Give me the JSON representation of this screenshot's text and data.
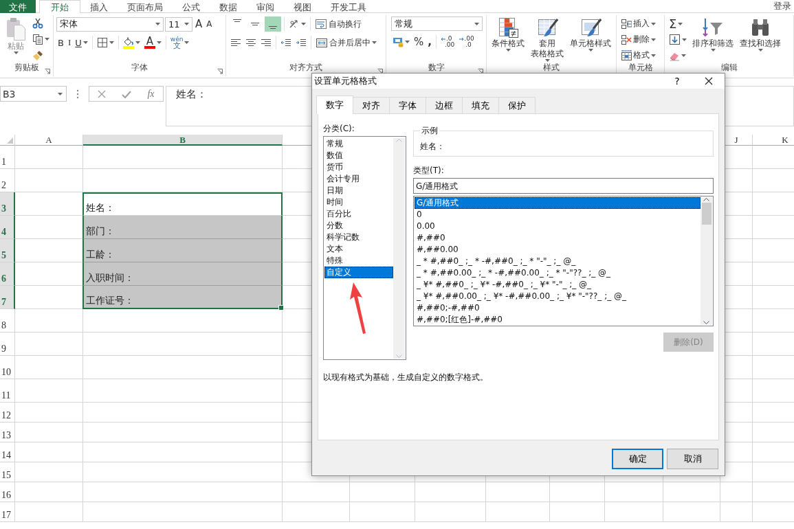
{
  "ribbon_tabs": [
    {
      "label": "文件",
      "kind": "file",
      "selected": false
    },
    {
      "label": "开始",
      "kind": "tab",
      "selected": true
    },
    {
      "label": "插入",
      "kind": "tab",
      "selected": false
    },
    {
      "label": "页面布局",
      "kind": "tab",
      "selected": false
    },
    {
      "label": "公式",
      "kind": "tab",
      "selected": false
    },
    {
      "label": "数据",
      "kind": "tab",
      "selected": false
    },
    {
      "label": "审阅",
      "kind": "tab",
      "selected": false
    },
    {
      "label": "视图",
      "kind": "tab",
      "selected": false
    },
    {
      "label": "开发工具",
      "kind": "tab",
      "selected": false
    }
  ],
  "account": "登录",
  "ribbon": {
    "clipboard": {
      "label": "剪贴板",
      "launcher": true,
      "paste": "粘贴",
      "paste_disabled": true
    },
    "font": {
      "label": "字体",
      "launcher": true,
      "font_name": "宋体",
      "font_size": "11",
      "grow": "A",
      "shrink": "A",
      "bold": "B",
      "italic": "I",
      "underline": "U",
      "fill": {
        "color": "#ffff00"
      },
      "font_color": {
        "letter": "A",
        "color": "#ff0000"
      },
      "phonetic_top": "wén",
      "phonetic_bottom": "文"
    },
    "alignment": {
      "label": "对齐方式",
      "launcher": true,
      "vertical": [
        {
          "selected": false
        },
        {
          "selected": false
        },
        {
          "selected": true
        }
      ],
      "wrap_text": "自动换行",
      "merge_center": "合并后居中"
    },
    "number": {
      "label": "数字",
      "launcher": true,
      "format": "常规",
      "percent": "%",
      "comma": ",",
      "increase_decimal": [
        ".0",
        ".00"
      ],
      "decrease_decimal": [
        ".00",
        ".0"
      ]
    },
    "styles": {
      "label": "样式",
      "conditional": "条件格式",
      "table_format": [
        "套用",
        "表格格式"
      ],
      "cell_styles": "单元格样式"
    },
    "cells": {
      "label": "单元格",
      "insert": "插入",
      "delete": "删除",
      "format": "格式"
    },
    "editing": {
      "label": "编辑",
      "autosum": "Σ",
      "sort_filter": "排序和筛选",
      "find_select": "查找和选择"
    }
  },
  "formula_bar": {
    "name_box": "B3",
    "function_button": "fx",
    "formula": "姓名："
  },
  "sheet": {
    "columns": [
      {
        "label": "A",
        "selected": false
      },
      {
        "label": "B",
        "selected": true
      },
      {
        "label": "J",
        "selected": false
      },
      {
        "label": "K",
        "selected": false
      }
    ],
    "rows": [
      {
        "number": "1",
        "selected": false
      },
      {
        "number": "2",
        "selected": false
      },
      {
        "number": "3",
        "selected": true,
        "cell_b": {
          "text": "姓名：",
          "filled": false
        }
      },
      {
        "number": "4",
        "selected": true,
        "cell_b": {
          "text": "部门：",
          "filled": true
        }
      },
      {
        "number": "5",
        "selected": true,
        "cell_b": {
          "text": "工龄：",
          "filled": true
        }
      },
      {
        "number": "6",
        "selected": true,
        "cell_b": {
          "text": "入职时间：",
          "filled": true
        }
      },
      {
        "number": "7",
        "selected": true,
        "cell_b": {
          "text": "工作证号：",
          "filled": true
        }
      },
      {
        "number": "8",
        "selected": false
      },
      {
        "number": "9",
        "selected": false
      },
      {
        "number": "10",
        "selected": false
      },
      {
        "number": "11",
        "selected": false
      },
      {
        "number": "12",
        "selected": false
      },
      {
        "number": "13",
        "selected": false
      },
      {
        "number": "14",
        "selected": false
      },
      {
        "number": "15",
        "selected": false
      },
      {
        "number": "16",
        "selected": false
      },
      {
        "number": "17",
        "selected": false
      }
    ]
  },
  "dialog": {
    "title": "设置单元格格式",
    "help": "?",
    "tabs": [
      {
        "label": "数字",
        "selected": true
      },
      {
        "label": "对齐",
        "selected": false
      },
      {
        "label": "字体",
        "selected": false
      },
      {
        "label": "边框",
        "selected": false
      },
      {
        "label": "填充",
        "selected": false
      },
      {
        "label": "保护",
        "selected": false
      }
    ],
    "category_label": "分类(C):",
    "categories": [
      {
        "label": "常规",
        "selected": false
      },
      {
        "label": "数值",
        "selected": false
      },
      {
        "label": "货币",
        "selected": false
      },
      {
        "label": "会计专用",
        "selected": false
      },
      {
        "label": "日期",
        "selected": false
      },
      {
        "label": "时间",
        "selected": false
      },
      {
        "label": "百分比",
        "selected": false
      },
      {
        "label": "分数",
        "selected": false
      },
      {
        "label": "科学记数",
        "selected": false
      },
      {
        "label": "文本",
        "selected": false
      },
      {
        "label": "特殊",
        "selected": false
      },
      {
        "label": "自定义",
        "selected": true
      }
    ],
    "sample_label": "示例",
    "sample_value": "姓名：",
    "type_label": "类型(T):",
    "type_value": "G/通用格式",
    "formats": [
      {
        "text": "G/通用格式",
        "selected": true
      },
      {
        "text": "0",
        "selected": false
      },
      {
        "text": "0.00",
        "selected": false
      },
      {
        "text": "#,##0",
        "selected": false
      },
      {
        "text": "#,##0.00",
        "selected": false
      },
      {
        "text": "_ * #,##0_ ;_ * -#,##0_ ;_ * \"-\"_ ;_ @_",
        "selected": false
      },
      {
        "text": "_ * #,##0.00_ ;_ * -#,##0.00_ ;_ * \"-\"??_ ;_ @_",
        "selected": false
      },
      {
        "text": "_ ¥* #,##0_ ;_ ¥* -#,##0_ ;_ ¥* \"-\"_ ;_ @_",
        "selected": false
      },
      {
        "text": "_ ¥* #,##0.00_ ;_ ¥* -#,##0.00_ ;_ ¥* \"-\"??_ ;_ @_",
        "selected": false
      },
      {
        "text": "#,##0;-#,##0",
        "selected": false
      },
      {
        "text": "#,##0;[红色]-#,##0",
        "selected": false
      }
    ],
    "delete_button": {
      "label": "删除(D)",
      "disabled": true
    },
    "description": "以现有格式为基础，生成自定义的数字格式。",
    "ok": "确定",
    "cancel": "取消"
  }
}
